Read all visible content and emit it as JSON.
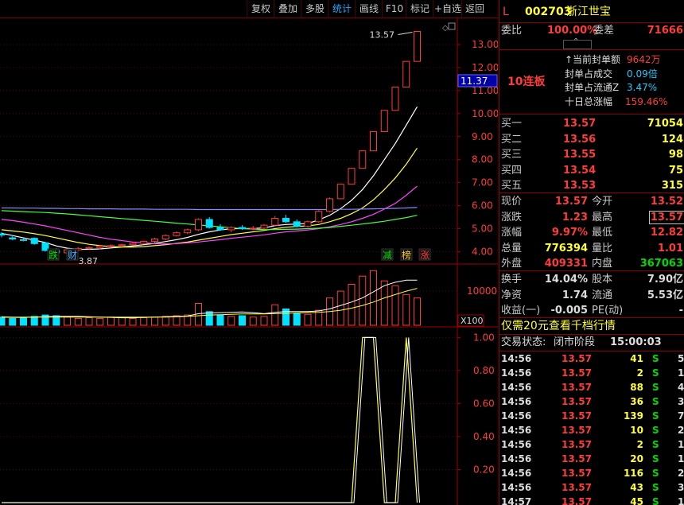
{
  "toolbar": {
    "buttons": [
      "复权",
      "叠加",
      "多股",
      "统计",
      "画线",
      "F10",
      "标记",
      "+自选",
      "返回"
    ],
    "active": "统计"
  },
  "chart": {
    "price_ticks": [
      "13.00",
      "12.00",
      "11.00",
      "10.00",
      "9.00",
      "8.00",
      "7.00",
      "6.00",
      "5.00",
      "4.00"
    ],
    "current_price_box": "11.37",
    "high_label": "13.57",
    "low_label": "3.87",
    "markers_left": [
      "跌",
      "财"
    ],
    "markers_right": [
      "减",
      "榜",
      "涨"
    ],
    "volume_tick": "10000",
    "volume_unit": "X100",
    "indicator_ticks": [
      "1.00",
      "0.80",
      "0.60",
      "0.40",
      "0.20"
    ]
  },
  "chart_data": {
    "type": "candlestick",
    "ylim": [
      3.6,
      13.9
    ],
    "candles": [
      {
        "o": 4.77,
        "h": 4.85,
        "l": 4.62,
        "c": 4.72
      },
      {
        "o": 4.6,
        "h": 4.72,
        "l": 4.5,
        "c": 4.55
      },
      {
        "o": 4.52,
        "h": 4.6,
        "l": 4.45,
        "c": 4.5
      },
      {
        "o": 4.58,
        "h": 4.62,
        "l": 4.3,
        "c": 4.35
      },
      {
        "o": 4.38,
        "h": 4.42,
        "l": 4.0,
        "c": 4.05
      },
      {
        "o": 4.05,
        "h": 4.15,
        "l": 3.9,
        "c": 3.95
      },
      {
        "o": 3.95,
        "h": 4.1,
        "l": 3.87,
        "c": 4.08
      },
      {
        "o": 4.08,
        "h": 4.2,
        "l": 4.02,
        "c": 4.14
      },
      {
        "o": 4.14,
        "h": 4.22,
        "l": 4.08,
        "c": 4.18
      },
      {
        "o": 4.18,
        "h": 4.3,
        "l": 4.1,
        "c": 4.24
      },
      {
        "o": 4.24,
        "h": 4.32,
        "l": 4.18,
        "c": 4.26
      },
      {
        "o": 4.26,
        "h": 4.34,
        "l": 4.2,
        "c": 4.3
      },
      {
        "o": 4.3,
        "h": 4.4,
        "l": 4.26,
        "c": 4.36
      },
      {
        "o": 4.36,
        "h": 4.48,
        "l": 4.32,
        "c": 4.45
      },
      {
        "o": 4.45,
        "h": 4.6,
        "l": 4.4,
        "c": 4.55
      },
      {
        "o": 4.55,
        "h": 4.75,
        "l": 4.5,
        "c": 4.7
      },
      {
        "o": 4.7,
        "h": 4.88,
        "l": 4.65,
        "c": 4.82
      },
      {
        "o": 4.82,
        "h": 5.0,
        "l": 4.76,
        "c": 4.95
      },
      {
        "o": 4.95,
        "h": 5.45,
        "l": 4.9,
        "c": 5.4
      },
      {
        "o": 5.4,
        "h": 5.5,
        "l": 5.0,
        "c": 5.05
      },
      {
        "o": 5.05,
        "h": 5.2,
        "l": 4.9,
        "c": 4.95
      },
      {
        "o": 4.95,
        "h": 5.1,
        "l": 4.85,
        "c": 5.05
      },
      {
        "o": 5.05,
        "h": 5.15,
        "l": 4.95,
        "c": 5.0
      },
      {
        "o": 5.0,
        "h": 5.12,
        "l": 4.92,
        "c": 5.02
      },
      {
        "o": 5.02,
        "h": 5.2,
        "l": 4.98,
        "c": 5.15
      },
      {
        "o": 5.15,
        "h": 5.55,
        "l": 5.1,
        "c": 5.45
      },
      {
        "o": 5.45,
        "h": 5.6,
        "l": 5.25,
        "c": 5.3
      },
      {
        "o": 5.3,
        "h": 5.4,
        "l": 5.05,
        "c": 5.1
      },
      {
        "o": 5.1,
        "h": 5.35,
        "l": 5.05,
        "c": 5.3
      },
      {
        "o": 5.3,
        "h": 5.8,
        "l": 5.25,
        "c": 5.75
      },
      {
        "o": 5.75,
        "h": 6.35,
        "l": 5.7,
        "c": 6.3
      },
      {
        "o": 6.3,
        "h": 6.95,
        "l": 6.3,
        "c": 6.93
      },
      {
        "o": 6.93,
        "h": 7.65,
        "l": 6.93,
        "c": 7.62
      },
      {
        "o": 7.62,
        "h": 8.4,
        "l": 7.62,
        "c": 8.38
      },
      {
        "o": 8.38,
        "h": 9.22,
        "l": 8.38,
        "c": 9.22
      },
      {
        "o": 9.22,
        "h": 10.14,
        "l": 9.22,
        "c": 10.14
      },
      {
        "o": 10.14,
        "h": 11.15,
        "l": 10.14,
        "c": 11.15
      },
      {
        "o": 11.15,
        "h": 12.27,
        "l": 11.15,
        "c": 12.27
      },
      {
        "o": 12.27,
        "h": 13.57,
        "l": 12.27,
        "c": 13.57
      }
    ],
    "ma": [
      {
        "name": "MA5",
        "color": "#ffffff",
        "values": [
          4.8,
          4.7,
          4.6,
          4.5,
          4.4,
          4.25,
          4.15,
          4.1,
          4.1,
          4.12,
          4.16,
          4.2,
          4.25,
          4.3,
          4.36,
          4.44,
          4.52,
          4.62,
          4.75,
          4.86,
          4.94,
          5.0,
          5.0,
          5.01,
          5.03,
          5.13,
          5.18,
          5.2,
          5.22,
          5.38,
          5.58,
          5.87,
          6.23,
          6.7,
          7.3,
          8.0,
          8.7,
          9.5,
          10.3
        ]
      },
      {
        "name": "MA10",
        "color": "#ffff44",
        "values": [
          4.95,
          4.9,
          4.85,
          4.78,
          4.7,
          4.6,
          4.5,
          4.4,
          4.32,
          4.26,
          4.22,
          4.2,
          4.2,
          4.22,
          4.26,
          4.3,
          4.36,
          4.42,
          4.5,
          4.58,
          4.66,
          4.74,
          4.8,
          4.86,
          4.92,
          5.0,
          5.06,
          5.1,
          5.12,
          5.18,
          5.3,
          5.45,
          5.65,
          5.9,
          6.25,
          6.7,
          7.2,
          7.8,
          8.5
        ]
      },
      {
        "name": "MA20",
        "color": "#ff44ff",
        "values": [
          5.4,
          5.35,
          5.28,
          5.2,
          5.12,
          5.02,
          4.92,
          4.82,
          4.72,
          4.62,
          4.54,
          4.48,
          4.42,
          4.38,
          4.35,
          4.34,
          4.35,
          4.38,
          4.42,
          4.47,
          4.52,
          4.58,
          4.63,
          4.68,
          4.73,
          4.8,
          4.86,
          4.9,
          4.94,
          5.0,
          5.08,
          5.18,
          5.3,
          5.45,
          5.62,
          5.85,
          6.1,
          6.45,
          6.85
        ]
      },
      {
        "name": "MA60",
        "color": "#44ff44",
        "values": [
          5.78,
          5.76,
          5.74,
          5.72,
          5.7,
          5.67,
          5.64,
          5.6,
          5.56,
          5.52,
          5.48,
          5.44,
          5.4,
          5.36,
          5.32,
          5.28,
          5.24,
          5.2,
          5.16,
          5.12,
          5.08,
          5.04,
          5.0,
          4.98,
          4.96,
          4.96,
          4.97,
          4.98,
          5.0,
          5.02,
          5.05,
          5.1,
          5.15,
          5.2,
          5.26,
          5.32,
          5.4,
          5.48,
          5.58
        ]
      },
      {
        "name": "MA120",
        "color": "#8888ff",
        "values": [
          5.9,
          5.9,
          5.89,
          5.89,
          5.88,
          5.88,
          5.87,
          5.87,
          5.86,
          5.86,
          5.86,
          5.85,
          5.85,
          5.85,
          5.84,
          5.84,
          5.84,
          5.84,
          5.83,
          5.83,
          5.83,
          5.83,
          5.83,
          5.83,
          5.83,
          5.83,
          5.83,
          5.83,
          5.83,
          5.83,
          5.83,
          5.84,
          5.84,
          5.85,
          5.86,
          5.87,
          5.88,
          5.9,
          5.92
        ]
      }
    ],
    "volume": [
      1.2,
      1.0,
      1.1,
      1.3,
      1.5,
      1.4,
      1.2,
      1.0,
      1.1,
      1.0,
      1.2,
      1.1,
      1.0,
      1.1,
      1.2,
      1.3,
      1.4,
      1.5,
      3.2,
      2.0,
      1.5,
      1.3,
      1.4,
      1.2,
      1.3,
      3.0,
      2.4,
      1.8,
      1.6,
      2.2,
      4.0,
      5.0,
      6.0,
      7.2,
      8.0,
      6.5,
      5.8,
      4.5,
      4.0
    ],
    "volume_ma": [
      1.2,
      1.15,
      1.15,
      1.2,
      1.25,
      1.3,
      1.3,
      1.3,
      1.25,
      1.2,
      1.15,
      1.1,
      1.1,
      1.15,
      1.2,
      1.25,
      1.3,
      1.35,
      1.7,
      1.8,
      1.85,
      1.9,
      1.95,
      1.85,
      1.7,
      1.9,
      2.0,
      2.0,
      2.0,
      2.1,
      2.4,
      2.9,
      3.4,
      4.0,
      4.9,
      5.8,
      6.3,
      6.6,
      6.6
    ],
    "volume_ma2": [
      1.25,
      1.2,
      1.2,
      1.2,
      1.2,
      1.2,
      1.2,
      1.2,
      1.2,
      1.2,
      1.2,
      1.2,
      1.2,
      1.2,
      1.2,
      1.2,
      1.25,
      1.3,
      1.4,
      1.5,
      1.55,
      1.6,
      1.65,
      1.65,
      1.65,
      1.7,
      1.75,
      1.8,
      1.85,
      1.9,
      2.0,
      2.2,
      2.5,
      2.9,
      3.4,
      4.0,
      4.5,
      5.0,
      5.4
    ],
    "indicator": [
      0,
      0,
      0,
      0,
      0,
      0,
      0,
      0,
      0,
      0,
      0,
      0,
      0,
      0,
      0,
      0,
      0,
      0,
      0,
      0,
      0,
      0,
      0,
      0,
      0,
      0,
      0,
      0,
      0,
      0,
      0,
      0,
      0,
      1,
      1,
      0,
      0,
      1,
      0
    ],
    "indicator_ylim": [
      0,
      1.05
    ]
  },
  "panel": {
    "header": {
      "flag": "L",
      "code": "002703",
      "name": "浙江世宝"
    },
    "weibi": {
      "label": "委比",
      "value": "100.00%",
      "label2": "委差",
      "value2": "71666"
    },
    "seal": {
      "lianban": "10连板",
      "items": [
        {
          "label": "当前封单额",
          "value": "9642万"
        },
        {
          "label": "封单占成交",
          "value": "0.09倍"
        },
        {
          "label": "封单占流通Z",
          "value": "3.47%"
        },
        {
          "label": "十日总涨幅",
          "value": "159.46%"
        }
      ]
    },
    "bids": [
      {
        "label": "买一",
        "price": "13.57",
        "vol": "71054"
      },
      {
        "label": "买二",
        "price": "13.56",
        "vol": "124"
      },
      {
        "label": "买三",
        "price": "13.55",
        "vol": "98"
      },
      {
        "label": "买四",
        "price": "13.54",
        "vol": "75"
      },
      {
        "label": "买五",
        "price": "13.53",
        "vol": "315"
      }
    ],
    "quote": [
      {
        "l1": "现价",
        "v1": "13.57",
        "l2": "今开",
        "v2": "13.52"
      },
      {
        "l1": "涨跌",
        "v1": "1.23",
        "l2": "最高",
        "v2": "13.57"
      },
      {
        "l1": "涨幅",
        "v1": "9.97%",
        "l2": "最低",
        "v2": "12.82"
      },
      {
        "l1": "总量",
        "v1": "776394",
        "l2": "量比",
        "v2": "1.01"
      },
      {
        "l1": "外盘",
        "v1": "409331",
        "l2": "内盘",
        "v2": "367063"
      }
    ],
    "stats": [
      {
        "l1": "换手",
        "v1": "14.04%",
        "l2": "股本",
        "v2": "7.90亿"
      },
      {
        "l1": "净资",
        "v1": "1.74",
        "l2": "流通",
        "v2": "5.53亿"
      },
      {
        "l1": "收益(一)",
        "v1": "-0.005",
        "l2": "PE(动)",
        "v2": "-"
      }
    ],
    "promo": "仅需20元查看千档行情",
    "status": {
      "label": "交易状态:",
      "phase": "闭市阶段",
      "time": "15:00:03"
    },
    "trades": [
      {
        "time": "14:56",
        "price": "13.57",
        "vol": "41",
        "side": "S",
        "n": "5"
      },
      {
        "time": "14:56",
        "price": "13.57",
        "vol": "2",
        "side": "S",
        "n": "1"
      },
      {
        "time": "14:56",
        "price": "13.57",
        "vol": "88",
        "side": "S",
        "n": "4"
      },
      {
        "time": "14:56",
        "price": "13.57",
        "vol": "36",
        "side": "S",
        "n": "3"
      },
      {
        "time": "14:56",
        "price": "13.57",
        "vol": "139",
        "side": "S",
        "n": "7"
      },
      {
        "time": "14:56",
        "price": "13.57",
        "vol": "10",
        "side": "S",
        "n": "2"
      },
      {
        "time": "14:56",
        "price": "13.57",
        "vol": "2",
        "side": "S",
        "n": "1"
      },
      {
        "time": "14:56",
        "price": "13.57",
        "vol": "20",
        "side": "S",
        "n": "1"
      },
      {
        "time": "14:56",
        "price": "13.57",
        "vol": "116",
        "side": "S",
        "n": "2"
      },
      {
        "time": "14:56",
        "price": "13.57",
        "vol": "43",
        "side": "S",
        "n": "3"
      },
      {
        "time": "14:57",
        "price": "13.57",
        "vol": "45",
        "side": "S",
        "n": "1"
      }
    ]
  }
}
